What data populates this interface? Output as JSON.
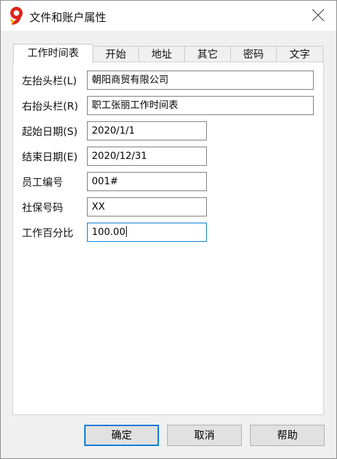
{
  "window": {
    "title": "文件和账户属性"
  },
  "tabs": [
    {
      "label": "工作时间表",
      "active": true
    },
    {
      "label": "开始"
    },
    {
      "label": "地址"
    },
    {
      "label": "其它"
    },
    {
      "label": "密码"
    },
    {
      "label": "文字"
    }
  ],
  "form": {
    "left_header": {
      "label": "左抬头栏(L)",
      "value": "朝阳商贸有限公司"
    },
    "right_header": {
      "label": "右抬头栏(R)",
      "value": "职工张丽工作时间表"
    },
    "start_date": {
      "label": "起始日期(S)",
      "value": "2020/1/1"
    },
    "end_date": {
      "label": "结束日期(E)",
      "value": "2020/12/31"
    },
    "employee_id": {
      "label": "员工编号",
      "value": "001#"
    },
    "social_security": {
      "label": "社保号码",
      "value": "XX"
    },
    "work_percent": {
      "label": "工作百分比",
      "value": "100.00"
    }
  },
  "buttons": {
    "ok": "确定",
    "cancel": "取消",
    "help": "帮助"
  },
  "icons": {
    "app": "app-logo-icon",
    "close": "close-icon"
  },
  "colors": {
    "logo_red": "#e0241b",
    "logo_yellow": "#f5b800",
    "focus_blue": "#0078d7"
  }
}
